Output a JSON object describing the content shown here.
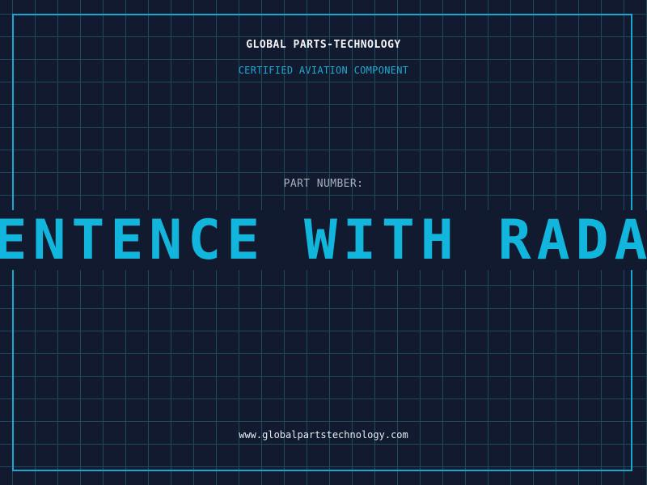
{
  "header": {
    "company": "GLOBAL PARTS-TECHNOLOGY",
    "subtitle": "CERTIFIED AVIATION COMPONENT"
  },
  "part": {
    "label": "PART NUMBER:",
    "value": "SENTENCE WITH RADAR"
  },
  "footer": {
    "url": "www.globalpartstechnology.com"
  },
  "colors": {
    "background": "#111a2e",
    "grid": "#1e4a5e",
    "accent": "#12b6dc",
    "frame": "#1aa7cf"
  }
}
